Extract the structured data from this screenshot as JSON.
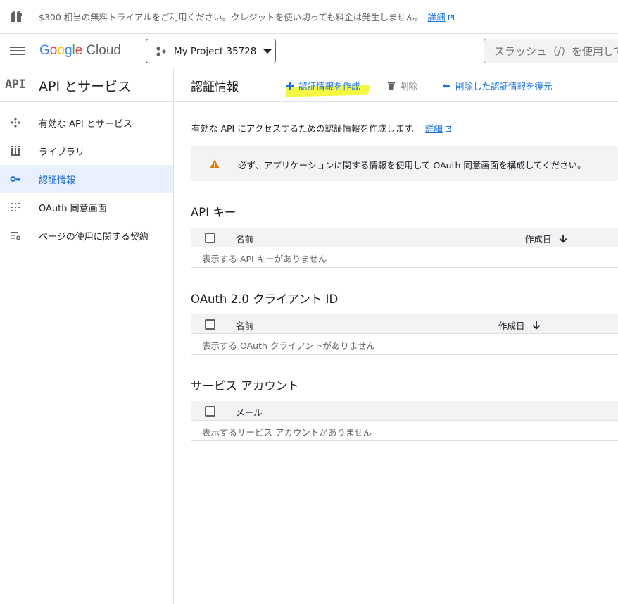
{
  "banner": {
    "text": "$300 相当の無料トライアルをご利用ください。クレジットを使い切っても料金は発生しません。",
    "link": "詳細"
  },
  "header": {
    "logo_google": [
      "G",
      "o",
      "o",
      "g",
      "l",
      "e"
    ],
    "logo_cloud": "Cloud",
    "project_name": "My Project 35728",
    "search_placeholder": "スラッシュ（/）を使用して"
  },
  "sidebar": {
    "api_logo": "API",
    "title": "API とサービス",
    "items": [
      {
        "label": "有効な API とサービス",
        "icon": "api-services-icon"
      },
      {
        "label": "ライブラリ",
        "icon": "library-icon"
      },
      {
        "label": "認証情報",
        "icon": "key-icon",
        "active": true
      },
      {
        "label": "OAuth 同意画面",
        "icon": "oauth-consent-icon"
      },
      {
        "label": "ページの使用に関する契約",
        "icon": "page-usage-agreement-icon"
      }
    ]
  },
  "toolbar": {
    "title": "認証情報",
    "create_label": "認証情報を作成",
    "delete_label": "削除",
    "restore_label": "削除した認証情報を復元"
  },
  "main": {
    "description": "有効な API にアクセスするための認証情報を作成します。",
    "description_link": "詳細",
    "warning": "必ず、アプリケーションに関する情報を使用して OAuth 同意画面を構成してください。",
    "sections": [
      {
        "title": "API キー",
        "col_name": "名前",
        "col_date": "作成日",
        "empty": "表示する API キーがありません"
      },
      {
        "title": "OAuth 2.0 クライアント ID",
        "col_name": "名前",
        "col_date": "作成日",
        "empty": "表示する OAuth クライアントがありません"
      },
      {
        "title": "サービス アカウント",
        "col_name": "メール",
        "empty": "表示するサービス アカウントがありません"
      }
    ]
  },
  "colors": {
    "accent": "#1a73e8",
    "active_bg": "#e8f0fe",
    "warning": "#e37400",
    "highlight": "#f3f720"
  }
}
